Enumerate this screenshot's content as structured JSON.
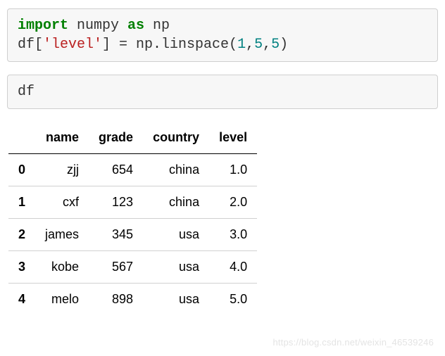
{
  "code_cell_1": {
    "kw_import": "import",
    "mod_numpy": " numpy ",
    "kw_as": "as",
    "mod_np": " np",
    "line2_prefix": "df[",
    "str_level": "'level'",
    "line2_mid": "] = np.linspace(",
    "n1": "1",
    "c1": ",",
    "n2": "5",
    "c2": ",",
    "n3": "5",
    "line2_end": ")"
  },
  "code_cell_2": {
    "text": "df"
  },
  "chart_data": {
    "type": "table",
    "columns": [
      "name",
      "grade",
      "country",
      "level"
    ],
    "index": [
      "0",
      "1",
      "2",
      "3",
      "4"
    ],
    "rows": [
      {
        "name": "zjj",
        "grade": "654",
        "country": "china",
        "level": "1.0"
      },
      {
        "name": "cxf",
        "grade": "123",
        "country": "china",
        "level": "2.0"
      },
      {
        "name": "james",
        "grade": "345",
        "country": "usa",
        "level": "3.0"
      },
      {
        "name": "kobe",
        "grade": "567",
        "country": "usa",
        "level": "4.0"
      },
      {
        "name": "melo",
        "grade": "898",
        "country": "usa",
        "level": "5.0"
      }
    ]
  },
  "watermark": "https://blog.csdn.net/weixin_46539246"
}
